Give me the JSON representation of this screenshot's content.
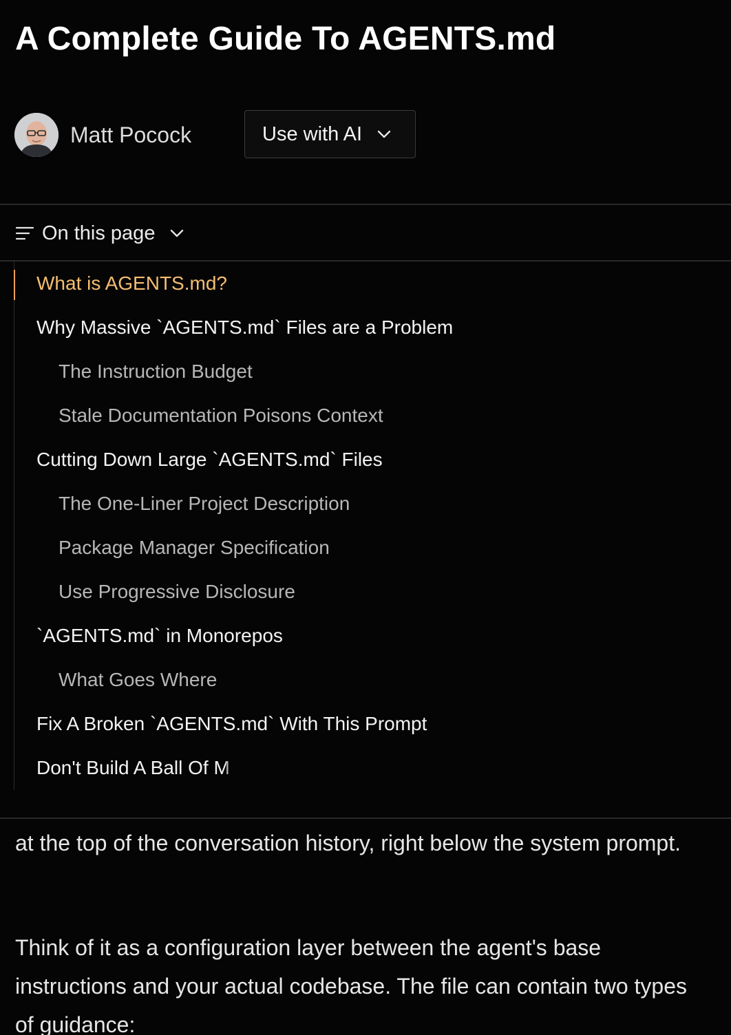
{
  "article": {
    "title": "A Complete Guide To AGENTS.md",
    "author": "Matt Pocock",
    "use_with_ai_label": "Use with AI"
  },
  "toc": {
    "toggle_label": "On this page",
    "items": [
      {
        "label": "What is AGENTS.md?",
        "level": 1,
        "active": true
      },
      {
        "label": "Why Massive `AGENTS.md` Files are a Problem",
        "level": 1
      },
      {
        "label": "The Instruction Budget",
        "level": 2
      },
      {
        "label": "Stale Documentation Poisons Context",
        "level": 2
      },
      {
        "label": "Cutting Down Large `AGENTS.md` Files",
        "level": 1
      },
      {
        "label": "The One-Liner Project Description",
        "level": 2
      },
      {
        "label": "Package Manager Specification",
        "level": 2
      },
      {
        "label": "Use Progressive Disclosure",
        "level": 2
      },
      {
        "label": "`AGENTS.md` in Monorepos",
        "level": 1
      },
      {
        "label": "What Goes Where",
        "level": 2
      },
      {
        "label": "Fix A Broken `AGENTS.md` With This Prompt",
        "level": 1
      },
      {
        "label": "Don't Build A Ball Of M",
        "level": 1
      }
    ]
  },
  "content": {
    "paragraph_1": "at the top of the conversation history, right below the system prompt.",
    "paragraph_2": "Think of it as a configuration layer between the agent's base instructions and your actual codebase. The file can contain two types of guidance:"
  },
  "colors": {
    "background": "#050505",
    "active_link": "#f6be72",
    "active_indicator": "#f0a15a",
    "divider": "#2a2a2a"
  },
  "icons": {
    "avatar": "author-avatar",
    "dropdown": "chevron-down-icon",
    "menu": "menu-lines-icon"
  }
}
